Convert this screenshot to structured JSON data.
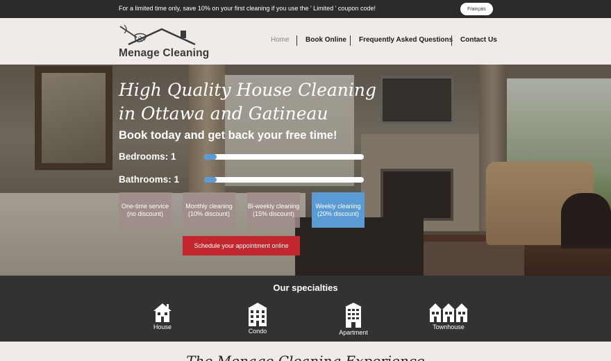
{
  "promo": {
    "text": "For a limited time only, save 10% on your first cleaning if you use the ' Limited ' coupon code!",
    "language_button": "Français"
  },
  "header": {
    "logo_text": "Menage Cleaning",
    "nav": [
      {
        "label": "Home",
        "active": true
      },
      {
        "label": "Book Online",
        "active": false
      },
      {
        "label": "Frequently Asked Questions",
        "active": false
      },
      {
        "label": "Contact Us",
        "active": false
      }
    ]
  },
  "hero": {
    "title_line1": "High Quality House Cleaning",
    "title_line2": "in Ottawa and Gatineau",
    "subtitle": "Book today and get back your free time!",
    "bedrooms_label": "Bedrooms: 1",
    "bathrooms_label": "Bathrooms: 1",
    "bedrooms_value": 1,
    "bathrooms_value": 1,
    "options": [
      {
        "line1": "One-time service",
        "line2": "(no discount)",
        "selected": false
      },
      {
        "line1": "Monthly cleaning",
        "line2": "(10% discount)",
        "selected": false
      },
      {
        "line1": "Bi-weekly cleaning",
        "line2": "(15% discount)",
        "selected": false
      },
      {
        "line1": "Weekly cleaning",
        "line2": "(20% discount)",
        "selected": true
      }
    ],
    "cta_label": "Schedule your appointment online"
  },
  "specialties": {
    "title": "Our specialties",
    "items": [
      {
        "label": "House",
        "icon": "house-icon"
      },
      {
        "label": "Condo",
        "icon": "condo-icon"
      },
      {
        "label": "Apartment",
        "icon": "apartment-icon"
      },
      {
        "label": "Townhouse",
        "icon": "townhouse-icon"
      }
    ]
  },
  "bottom": {
    "title": "The Menage Cleaning Experience"
  },
  "colors": {
    "accent_blue": "#5b9bd5",
    "cta_red": "#c4262e",
    "dark_bar": "#2b2b2b",
    "specialties_bg": "#323232",
    "header_bg": "#efebe8"
  }
}
